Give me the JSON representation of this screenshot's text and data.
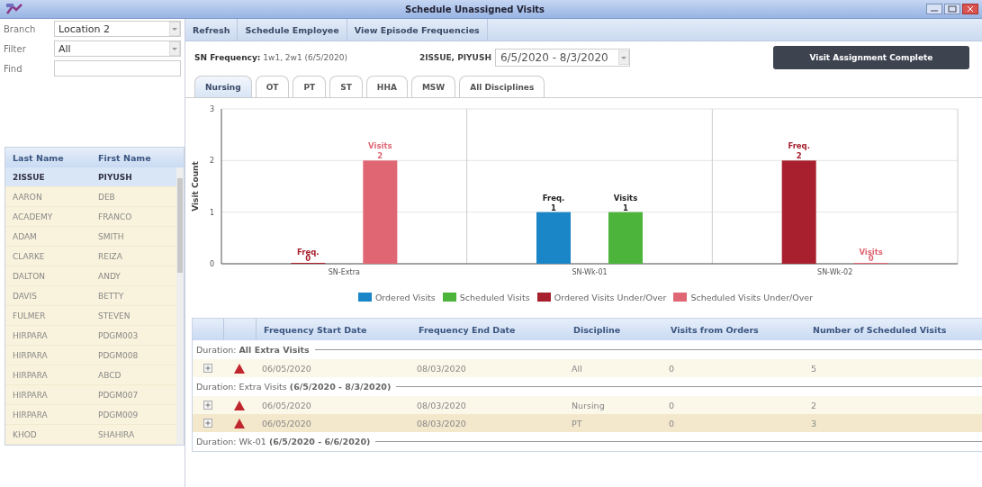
{
  "window": {
    "title": "Schedule Unassigned Visits"
  },
  "filters": [
    {
      "label": "Branch",
      "kind": "dropdown",
      "value": "Location 2"
    },
    {
      "label": "Filter",
      "kind": "dropdown",
      "value": "All"
    },
    {
      "label": "Find",
      "kind": "text"
    }
  ],
  "patients": {
    "columns": [
      "Last Name",
      "First Name"
    ],
    "rows": [
      {
        "last": "2ISSUE",
        "first": "PIYUSH",
        "selected": true
      },
      {
        "last": "AARON",
        "first": "DEB",
        "selected": false
      },
      {
        "last": "ACADEMY",
        "first": "FRANCO",
        "selected": false
      },
      {
        "last": "ADAM",
        "first": "SMITH",
        "selected": false
      },
      {
        "last": "CLARKE",
        "first": "REIZA",
        "selected": false
      },
      {
        "last": "DALTON",
        "first": "ANDY",
        "selected": false
      },
      {
        "last": "DAVIS",
        "first": "BETTY",
        "selected": false
      },
      {
        "last": "FULMER",
        "first": "STEVEN",
        "selected": false
      },
      {
        "last": "HIRPARA",
        "first": "PDGM003",
        "selected": false
      },
      {
        "last": "HIRPARA",
        "first": "PDGM008",
        "selected": false
      },
      {
        "last": "HIRPARA",
        "first": "ABCD",
        "selected": false
      },
      {
        "last": "HIRPARA",
        "first": "PDGM007",
        "selected": false
      },
      {
        "last": "HIRPARA",
        "first": "PDGM009",
        "selected": false
      },
      {
        "last": "KHOD",
        "first": "SHAHIRA",
        "selected": false
      }
    ]
  },
  "toolbar": [
    "Refresh",
    "Schedule Employee",
    "View Episode Frequencies"
  ],
  "frequency": {
    "label": "SN Frequency:",
    "value": "1w1, 2w1 (6/5/2020)"
  },
  "patient_name": "2ISSUE, PIYUSH",
  "episode": "6/5/2020 - 8/3/2020",
  "complete_button": "Visit Assignment Complete",
  "tabs": [
    {
      "label": "Nursing",
      "selected": true
    },
    {
      "label": "OT",
      "selected": false
    },
    {
      "label": "PT",
      "selected": false
    },
    {
      "label": "ST",
      "selected": false
    },
    {
      "label": "HHA",
      "selected": false
    },
    {
      "label": "MSW",
      "selected": false
    },
    {
      "label": "All Disciplines",
      "selected": false
    }
  ],
  "chart_data": {
    "type": "bar",
    "ylabel": "Visit Count",
    "categories": [
      "SN-Extra",
      "SN-Wk-01",
      "SN-Wk-02"
    ],
    "ylim": [
      0,
      3
    ],
    "yticks": [
      0,
      1,
      2,
      3
    ],
    "data_labels": true,
    "series": [
      {
        "name": "Ordered Visits",
        "color": "#1a86c8",
        "values": [
          null,
          1,
          null
        ]
      },
      {
        "name": "Scheduled Visits",
        "color": "#4cb43a",
        "values": [
          null,
          1,
          null
        ]
      },
      {
        "name": "Ordered Visits Under/Over",
        "color": "#a8202e",
        "values": [
          0,
          null,
          2
        ]
      },
      {
        "name": "Scheduled Visits Under/Over",
        "color": "#e06674",
        "values": [
          2,
          null,
          0
        ]
      }
    ],
    "annotations": [
      "Freq.",
      "Visits",
      "Freq.",
      "Visits",
      "Freq.",
      "Visits"
    ]
  },
  "table": {
    "columns": [
      "Frequency Start Date",
      "Frequency End Date",
      "Discipline",
      "Visits from Orders",
      "Number of Scheduled Visits"
    ],
    "rows": [
      {
        "kind": "group",
        "label": "Duration: **All Extra Visits**"
      },
      {
        "kind": "visit",
        "warning": true,
        "selected": false,
        "cells": [
          "06/05/2020",
          "08/03/2020",
          "All",
          "0",
          "5"
        ]
      },
      {
        "kind": "group",
        "label": "Duration: Extra Visits **(6/5/2020 - 8/3/2020)**"
      },
      {
        "kind": "visit",
        "warning": true,
        "selected": false,
        "cells": [
          "06/05/2020",
          "08/03/2020",
          "Nursing",
          "0",
          "2"
        ]
      },
      {
        "kind": "visit",
        "warning": true,
        "selected": true,
        "cells": [
          "06/05/2020",
          "08/03/2020",
          "PT",
          "0",
          "3"
        ]
      },
      {
        "kind": "group",
        "label": "Duration: Wk-01 **(6/5/2020 - 6/6/2020)**"
      }
    ]
  }
}
